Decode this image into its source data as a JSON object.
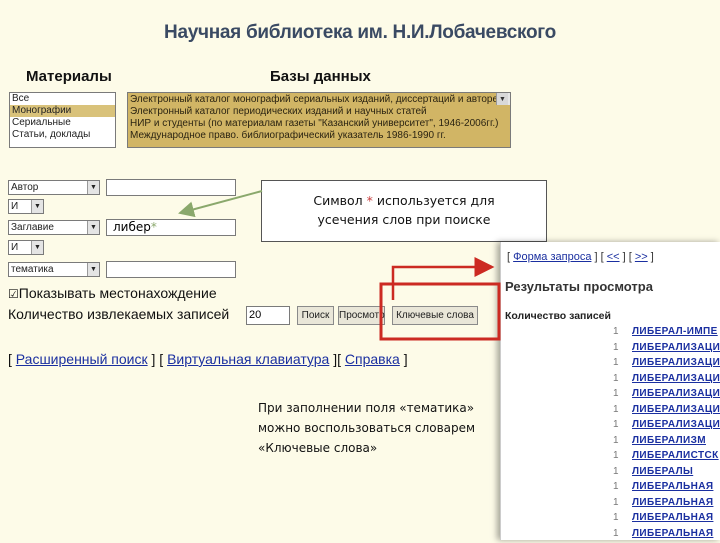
{
  "page_title": "Научная библиотека им. Н.И.Лобачевского",
  "materials": {
    "header": "Материалы",
    "items": [
      "Все",
      "Монографии",
      "Сериальные",
      "Статьи, доклады"
    ],
    "selected_index": 1
  },
  "databases": {
    "header": "Базы данных",
    "items": [
      "Электронный каталог монографий сериальных изданий, диссертаций и авторефератов",
      "Электронный каталог периодических изданий и научных статей",
      "НИР и студенты (по материалам газеты \"Казанский университет\", 1946-2006гг.)",
      "Международное право. библиографический указатель 1986-1990 гг."
    ]
  },
  "search_rows": [
    {
      "field": "Автор",
      "op": "И",
      "value": ""
    },
    {
      "field": "Заглавие",
      "op": "И",
      "value": "либер"
    },
    {
      "field": "тематика",
      "value": ""
    }
  ],
  "search_value_star": "*",
  "show_location": {
    "checkbox": "☑",
    "label": "Показывать местонахождение"
  },
  "records": {
    "label": "Количество извлекаемых записей",
    "value": "20"
  },
  "buttons": {
    "search": "Поиск",
    "reset": "Просмотр",
    "keywords": "Ключевые слова"
  },
  "bottom_links": {
    "advanced": "Расширенный поиск",
    "keyboard": "Виртуальная клавиатура",
    "help": "Справка"
  },
  "callout": {
    "line1_a": "Символ",
    "line1_star": "*",
    "line1_b": "используется для",
    "line2": "усечения слов при поиске"
  },
  "results": {
    "nav_form": "Форма запроса",
    "nav_prev": "<<",
    "nav_next": ">>",
    "title": "Результаты просмотра",
    "count_label": "Количество записей",
    "rows": [
      {
        "n": "1",
        "w": "ЛИБЕРАЛ-ИМПЕ"
      },
      {
        "n": "1",
        "w": "ЛИБЕРАЛИЗАЦИ"
      },
      {
        "n": "1",
        "w": "ЛИБЕРАЛИЗАЦИ"
      },
      {
        "n": "1",
        "w": "ЛИБЕРАЛИЗАЦИ"
      },
      {
        "n": "1",
        "w": "ЛИБЕРАЛИЗАЦИ"
      },
      {
        "n": "1",
        "w": "ЛИБЕРАЛИЗАЦИ"
      },
      {
        "n": "1",
        "w": "ЛИБЕРАЛИЗАЦИ"
      },
      {
        "n": "1",
        "w": "ЛИБЕРАЛИЗМ"
      },
      {
        "n": "1",
        "w": "ЛИБЕРАЛИСТСК"
      },
      {
        "n": "1",
        "w": "ЛИБЕРАЛЫ"
      },
      {
        "n": "1",
        "w": "ЛИБЕРАЛЬНАЯ"
      },
      {
        "n": "1",
        "w": "ЛИБЕРАЛЬНАЯ"
      },
      {
        "n": "1",
        "w": "ЛИБЕРАЛЬНАЯ"
      },
      {
        "n": "1",
        "w": "ЛИБЕРАЛЬНАЯ"
      }
    ]
  },
  "note": {
    "line1": "При заполнении поля «тематика»",
    "line2": "можно воспользоваться словарем",
    "line3": "«Ключевые слова»"
  },
  "colors": {
    "accent_red": "#cc2a22",
    "db_bg": "#d1b565",
    "link": "#1a2fa0"
  }
}
